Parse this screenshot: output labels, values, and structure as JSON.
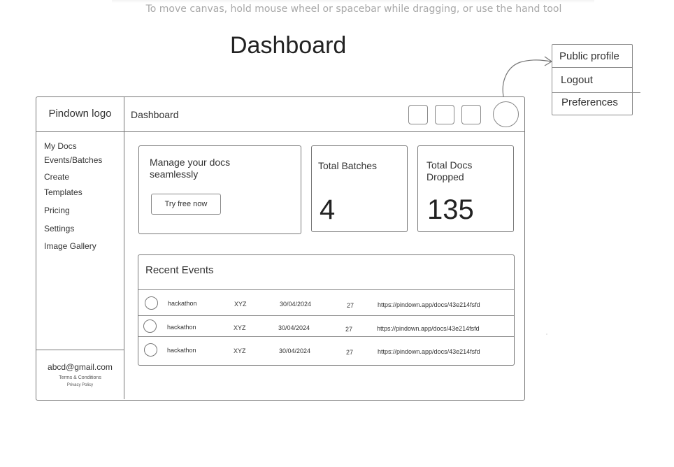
{
  "canvas_hint": "To move canvas, hold mouse wheel or spacebar while dragging, or use the hand tool",
  "page_heading": "Dashboard",
  "profile_menu": {
    "items": [
      "Public profile",
      "Logout",
      "Preferences"
    ]
  },
  "app": {
    "logo": "Pindown logo",
    "header_title": "Dashboard",
    "header_icons": [
      "toolbar-icon-1",
      "toolbar-icon-2",
      "toolbar-icon-3"
    ],
    "sidebar": {
      "items": [
        "My Docs",
        "Events/Batches",
        "Create",
        "Templates",
        "Pricing",
        "Settings",
        "Image Gallery"
      ],
      "email": "abcd@gmail.com",
      "terms": "Terms & Conditions",
      "privacy": "Privacy Policy"
    },
    "promo": {
      "text_line1": "Manage your docs",
      "text_line2": "seamlessly",
      "button": "Try free now"
    },
    "stats": [
      {
        "label_line1": "Total Batches",
        "label_line2": "",
        "value": "4"
      },
      {
        "label_line1": "Total Docs",
        "label_line2": "Dropped",
        "value": "135"
      }
    ],
    "recent_events": {
      "title": "Recent Events",
      "rows": [
        {
          "name": "hackathon",
          "org": "XYZ",
          "date": "30/04/2024",
          "count": "27",
          "url": "https://pindown.app/docs/43e214fsfd"
        },
        {
          "name": "hackathon",
          "org": "XYZ",
          "date": "30/04/2024",
          "count": "27",
          "url": "https://pindown.app/docs/43e214fsfd"
        },
        {
          "name": "hackathon",
          "org": "XYZ",
          "date": "30/04/2024",
          "count": "27",
          "url": "https://pindown.app/docs/43e214fsfd"
        }
      ]
    }
  },
  "stray_mark": "°"
}
